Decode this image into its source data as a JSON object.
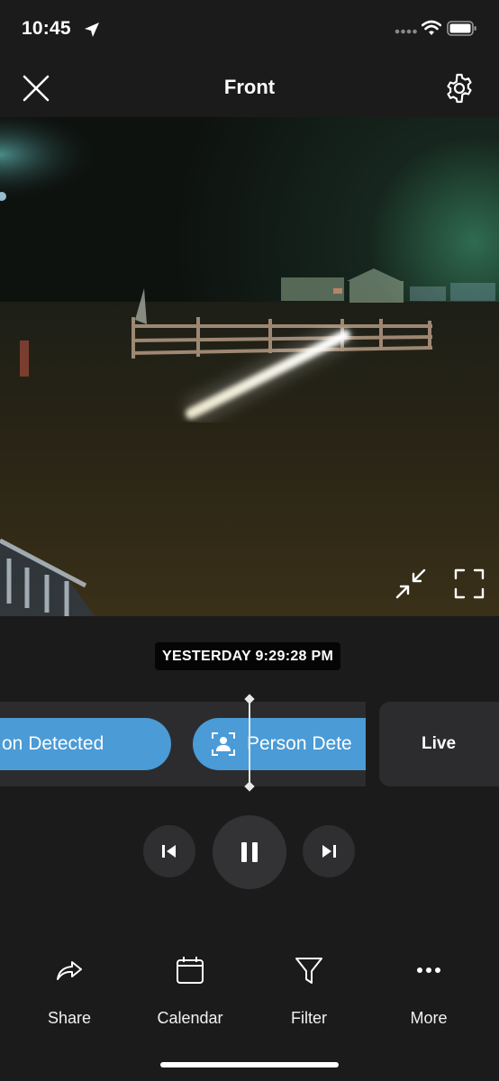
{
  "status_bar": {
    "time": "10:45"
  },
  "nav": {
    "title": "Front"
  },
  "video": {
    "timestamp": "YESTERDAY 9:29:28 PM"
  },
  "timeline": {
    "events": [
      {
        "label": "on Detected"
      },
      {
        "label": "Person Dete"
      }
    ],
    "live_label": "Live"
  },
  "toolbar": {
    "share": "Share",
    "calendar": "Calendar",
    "filter": "Filter",
    "more": "More"
  },
  "colors": {
    "background": "#1b1b1b",
    "accent_event": "#4a9bd6",
    "panel": "#2c2c2e"
  },
  "icons": [
    "close-icon",
    "gear-icon",
    "minimize-icon",
    "fullscreen-icon",
    "person-icon",
    "previous-icon",
    "pause-icon",
    "next-icon",
    "share-icon",
    "calendar-icon",
    "filter-icon",
    "more-icon"
  ]
}
